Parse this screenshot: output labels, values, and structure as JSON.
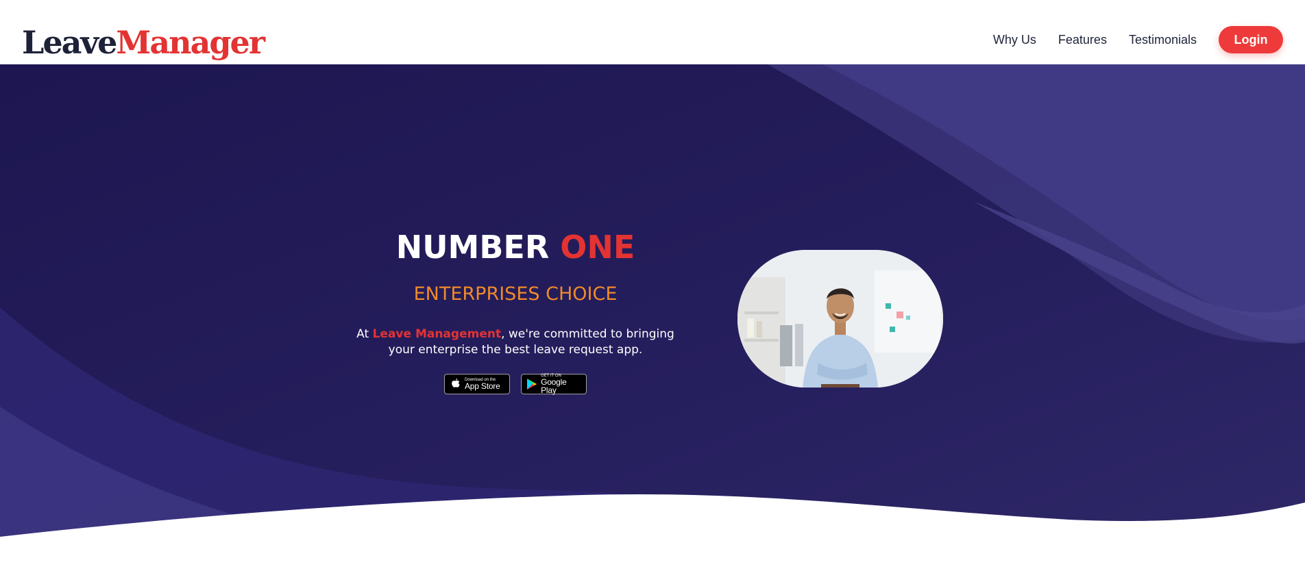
{
  "header": {
    "logo_part1": "Leave",
    "logo_part2": "Manager",
    "nav_items": [
      "Why Us",
      "Features",
      "Testimonials"
    ],
    "login_label": "Login"
  },
  "hero": {
    "headline_part1": "NUMBER ",
    "headline_part2": "ONE",
    "subheadline": "ENTERPRISES CHOICE",
    "desc_prefix": "At ",
    "desc_brand": "Leave Management",
    "desc_line1_rest": ", we're committed to bringing",
    "desc_line2": "your enterprise the best leave request app.",
    "app_store_small": "Download on the",
    "app_store_big": "App Store",
    "google_play_small": "GET IT ON",
    "google_play_big": "Google Play"
  },
  "colors": {
    "brand_red": "#e33333",
    "navy": "#1e2238",
    "hero_bg": "#241d58",
    "accent_orange": "#f08a2a"
  },
  "icons": [
    "apple-icon",
    "google-play-icon"
  ]
}
